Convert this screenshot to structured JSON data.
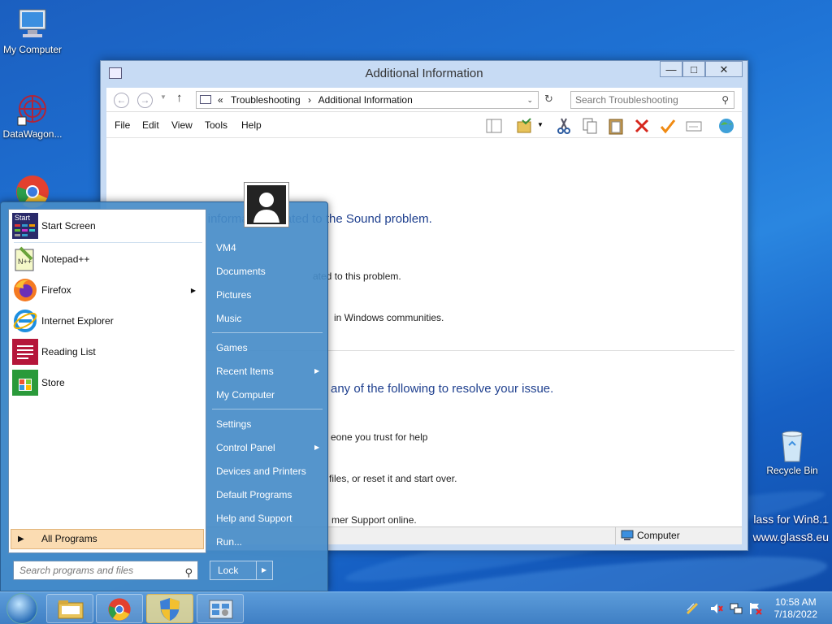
{
  "desktop": {
    "icons": [
      {
        "label": "My Computer"
      },
      {
        "label": "DataWagon..."
      },
      {
        "label": "Recycle Bin"
      }
    ],
    "watermark_line1": "lass for Win8.1",
    "watermark_line2": "www.glass8.eu"
  },
  "window": {
    "title": "Additional Information",
    "controls": {
      "minimize": "—",
      "maximize": "□",
      "close": "✕"
    },
    "breadcrumb": {
      "prefix": "«",
      "items": [
        "Troubleshooting",
        "Additional Information"
      ],
      "separator": "›"
    },
    "search_placeholder": "Search Troubleshooting",
    "menu": [
      "File",
      "Edit",
      "View",
      "Tools",
      "Help"
    ],
    "content": {
      "heading1": "Find additional information related to the Sound problem.",
      "line1": "ated to this problem.",
      "line2": "in Windows communities.",
      "heading2": "any of the following to resolve your issue.",
      "line3": "eone you trust for help",
      "line4": "files, or reset it and start over.",
      "line5": "mer Support online."
    },
    "status": "Computer"
  },
  "start_menu": {
    "left_items": [
      {
        "label": "Start Screen",
        "icon": "start-screen-icon"
      },
      {
        "label": "Notepad++",
        "icon": "notepadpp-icon"
      },
      {
        "label": "Firefox",
        "icon": "firefox-icon",
        "submenu": true
      },
      {
        "label": "Internet Explorer",
        "icon": "ie-icon"
      },
      {
        "label": "Reading List",
        "icon": "reading-list-icon"
      },
      {
        "label": "Store",
        "icon": "store-icon"
      }
    ],
    "start_tile_text": "Start",
    "all_programs": "All Programs",
    "search_placeholder": "Search programs and files",
    "right_items": [
      {
        "label": "VM4"
      },
      {
        "label": "Documents"
      },
      {
        "label": "Pictures"
      },
      {
        "label": "Music"
      },
      {
        "label": "Games"
      },
      {
        "label": "Recent Items",
        "submenu": true
      },
      {
        "label": "My Computer"
      },
      {
        "label": "Settings"
      },
      {
        "label": "Control Panel",
        "submenu": true
      },
      {
        "label": "Devices and Printers"
      },
      {
        "label": "Default Programs"
      },
      {
        "label": "Help and Support"
      },
      {
        "label": "Run..."
      }
    ],
    "lock_label": "Lock"
  },
  "taskbar": {
    "clock_time": "10:58 AM",
    "clock_date": "7/18/2022"
  },
  "colors": {
    "heading_blue": "#1e3f8e",
    "active_taskbar": "#fbdcb2"
  }
}
